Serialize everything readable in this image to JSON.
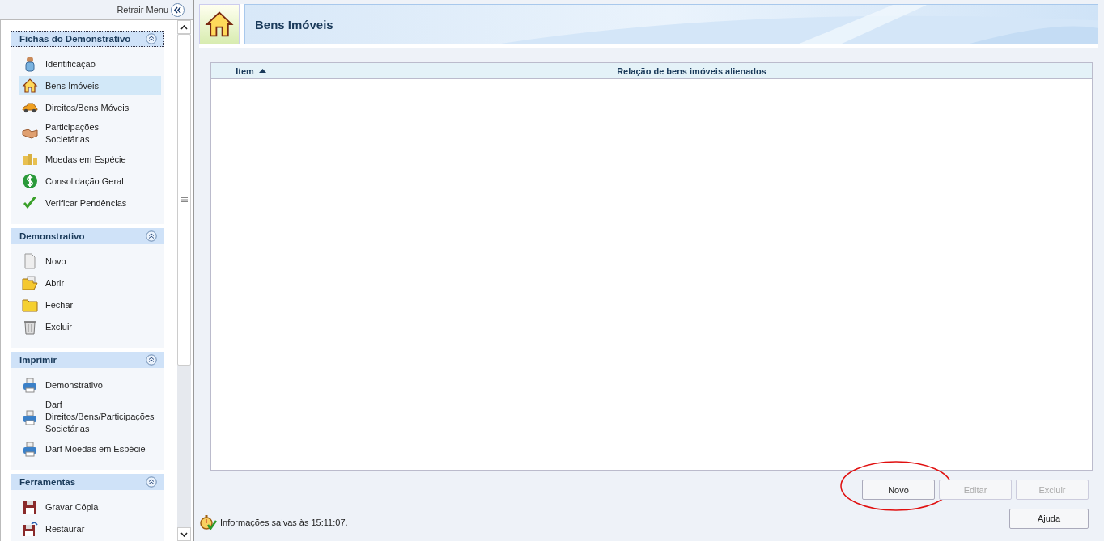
{
  "sidebar": {
    "collapse_label": "Retrair Menu",
    "sections": [
      {
        "title": "Fichas do Demonstrativo",
        "expanded": true,
        "focused": true,
        "items": [
          {
            "label": "Identificação",
            "selected": false
          },
          {
            "label": "Bens Imóveis",
            "selected": true
          },
          {
            "label": "Direitos/Bens Móveis",
            "selected": false
          },
          {
            "label": "Participações\nSocietárias",
            "selected": false
          },
          {
            "label": "Moedas em Espécie",
            "selected": false
          },
          {
            "label": "Consolidação Geral",
            "selected": false
          },
          {
            "label": "Verificar Pendências",
            "selected": false
          }
        ]
      },
      {
        "title": "Demonstrativo",
        "expanded": true,
        "focused": false,
        "items": [
          {
            "label": "Novo",
            "selected": false
          },
          {
            "label": "Abrir",
            "selected": false
          },
          {
            "label": "Fechar",
            "selected": false
          },
          {
            "label": "Excluir",
            "selected": false
          }
        ]
      },
      {
        "title": "Imprimir",
        "expanded": true,
        "focused": false,
        "items": [
          {
            "label": "Demonstrativo",
            "selected": false
          },
          {
            "label": "Darf\nDireitos/Bens/Participações\nSocietárias",
            "selected": false
          },
          {
            "label": "Darf Moedas em Espécie",
            "selected": false
          }
        ]
      },
      {
        "title": "Ferramentas",
        "expanded": true,
        "focused": false,
        "items": [
          {
            "label": "Gravar Cópia",
            "selected": false
          },
          {
            "label": "Restaurar",
            "selected": false
          }
        ]
      }
    ]
  },
  "page": {
    "title": "Bens Imóveis"
  },
  "table": {
    "columns": [
      {
        "label": "Item",
        "sort_ascending": true
      },
      {
        "label": "Relação de bens imóveis alienados"
      }
    ]
  },
  "buttons": [
    {
      "label": "Novo",
      "disabled": false,
      "highlighted": true
    },
    {
      "label": "Editar",
      "disabled": true,
      "highlighted": false
    },
    {
      "label": "Excluir",
      "disabled": true,
      "highlighted": false
    }
  ],
  "status": "Informações salvas às 15:11:07.",
  "help_button": {
    "label": "Ajuda"
  }
}
